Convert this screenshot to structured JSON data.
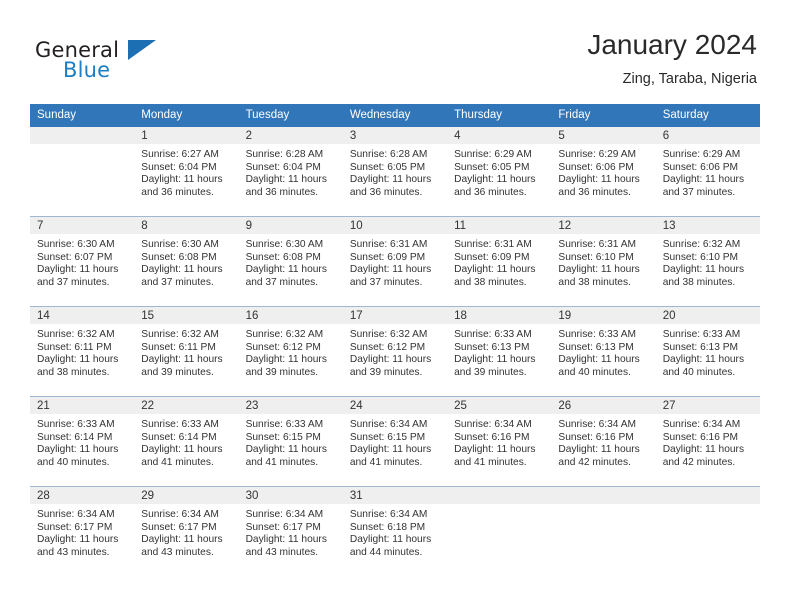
{
  "brand": {
    "name_part1": "General",
    "name_part2": "Blue",
    "accent_color": "#1d6fb4"
  },
  "header": {
    "title": "January 2024",
    "subtitle": "Zing, Taraba, Nigeria"
  },
  "calendar": {
    "header_bg_color": "#3076b8",
    "daynum_band_color": "#efefef",
    "weekday_headers": [
      "Sunday",
      "Monday",
      "Tuesday",
      "Wednesday",
      "Thursday",
      "Friday",
      "Saturday"
    ],
    "weeks": [
      [
        {
          "day": "",
          "sunrise": "",
          "sunset": "",
          "daylight_line1": "",
          "daylight_line2": "",
          "empty": true
        },
        {
          "day": "1",
          "sunrise": "Sunrise: 6:27 AM",
          "sunset": "Sunset: 6:04 PM",
          "daylight_line1": "Daylight: 11 hours",
          "daylight_line2": "and 36 minutes.",
          "empty": false
        },
        {
          "day": "2",
          "sunrise": "Sunrise: 6:28 AM",
          "sunset": "Sunset: 6:04 PM",
          "daylight_line1": "Daylight: 11 hours",
          "daylight_line2": "and 36 minutes.",
          "empty": false
        },
        {
          "day": "3",
          "sunrise": "Sunrise: 6:28 AM",
          "sunset": "Sunset: 6:05 PM",
          "daylight_line1": "Daylight: 11 hours",
          "daylight_line2": "and 36 minutes.",
          "empty": false
        },
        {
          "day": "4",
          "sunrise": "Sunrise: 6:29 AM",
          "sunset": "Sunset: 6:05 PM",
          "daylight_line1": "Daylight: 11 hours",
          "daylight_line2": "and 36 minutes.",
          "empty": false
        },
        {
          "day": "5",
          "sunrise": "Sunrise: 6:29 AM",
          "sunset": "Sunset: 6:06 PM",
          "daylight_line1": "Daylight: 11 hours",
          "daylight_line2": "and 36 minutes.",
          "empty": false
        },
        {
          "day": "6",
          "sunrise": "Sunrise: 6:29 AM",
          "sunset": "Sunset: 6:06 PM",
          "daylight_line1": "Daylight: 11 hours",
          "daylight_line2": "and 37 minutes.",
          "empty": false
        }
      ],
      [
        {
          "day": "7",
          "sunrise": "Sunrise: 6:30 AM",
          "sunset": "Sunset: 6:07 PM",
          "daylight_line1": "Daylight: 11 hours",
          "daylight_line2": "and 37 minutes.",
          "empty": false
        },
        {
          "day": "8",
          "sunrise": "Sunrise: 6:30 AM",
          "sunset": "Sunset: 6:08 PM",
          "daylight_line1": "Daylight: 11 hours",
          "daylight_line2": "and 37 minutes.",
          "empty": false
        },
        {
          "day": "9",
          "sunrise": "Sunrise: 6:30 AM",
          "sunset": "Sunset: 6:08 PM",
          "daylight_line1": "Daylight: 11 hours",
          "daylight_line2": "and 37 minutes.",
          "empty": false
        },
        {
          "day": "10",
          "sunrise": "Sunrise: 6:31 AM",
          "sunset": "Sunset: 6:09 PM",
          "daylight_line1": "Daylight: 11 hours",
          "daylight_line2": "and 37 minutes.",
          "empty": false
        },
        {
          "day": "11",
          "sunrise": "Sunrise: 6:31 AM",
          "sunset": "Sunset: 6:09 PM",
          "daylight_line1": "Daylight: 11 hours",
          "daylight_line2": "and 38 minutes.",
          "empty": false
        },
        {
          "day": "12",
          "sunrise": "Sunrise: 6:31 AM",
          "sunset": "Sunset: 6:10 PM",
          "daylight_line1": "Daylight: 11 hours",
          "daylight_line2": "and 38 minutes.",
          "empty": false
        },
        {
          "day": "13",
          "sunrise": "Sunrise: 6:32 AM",
          "sunset": "Sunset: 6:10 PM",
          "daylight_line1": "Daylight: 11 hours",
          "daylight_line2": "and 38 minutes.",
          "empty": false
        }
      ],
      [
        {
          "day": "14",
          "sunrise": "Sunrise: 6:32 AM",
          "sunset": "Sunset: 6:11 PM",
          "daylight_line1": "Daylight: 11 hours",
          "daylight_line2": "and 38 minutes.",
          "empty": false
        },
        {
          "day": "15",
          "sunrise": "Sunrise: 6:32 AM",
          "sunset": "Sunset: 6:11 PM",
          "daylight_line1": "Daylight: 11 hours",
          "daylight_line2": "and 39 minutes.",
          "empty": false
        },
        {
          "day": "16",
          "sunrise": "Sunrise: 6:32 AM",
          "sunset": "Sunset: 6:12 PM",
          "daylight_line1": "Daylight: 11 hours",
          "daylight_line2": "and 39 minutes.",
          "empty": false
        },
        {
          "day": "17",
          "sunrise": "Sunrise: 6:32 AM",
          "sunset": "Sunset: 6:12 PM",
          "daylight_line1": "Daylight: 11 hours",
          "daylight_line2": "and 39 minutes.",
          "empty": false
        },
        {
          "day": "18",
          "sunrise": "Sunrise: 6:33 AM",
          "sunset": "Sunset: 6:13 PM",
          "daylight_line1": "Daylight: 11 hours",
          "daylight_line2": "and 39 minutes.",
          "empty": false
        },
        {
          "day": "19",
          "sunrise": "Sunrise: 6:33 AM",
          "sunset": "Sunset: 6:13 PM",
          "daylight_line1": "Daylight: 11 hours",
          "daylight_line2": "and 40 minutes.",
          "empty": false
        },
        {
          "day": "20",
          "sunrise": "Sunrise: 6:33 AM",
          "sunset": "Sunset: 6:13 PM",
          "daylight_line1": "Daylight: 11 hours",
          "daylight_line2": "and 40 minutes.",
          "empty": false
        }
      ],
      [
        {
          "day": "21",
          "sunrise": "Sunrise: 6:33 AM",
          "sunset": "Sunset: 6:14 PM",
          "daylight_line1": "Daylight: 11 hours",
          "daylight_line2": "and 40 minutes.",
          "empty": false
        },
        {
          "day": "22",
          "sunrise": "Sunrise: 6:33 AM",
          "sunset": "Sunset: 6:14 PM",
          "daylight_line1": "Daylight: 11 hours",
          "daylight_line2": "and 41 minutes.",
          "empty": false
        },
        {
          "day": "23",
          "sunrise": "Sunrise: 6:33 AM",
          "sunset": "Sunset: 6:15 PM",
          "daylight_line1": "Daylight: 11 hours",
          "daylight_line2": "and 41 minutes.",
          "empty": false
        },
        {
          "day": "24",
          "sunrise": "Sunrise: 6:34 AM",
          "sunset": "Sunset: 6:15 PM",
          "daylight_line1": "Daylight: 11 hours",
          "daylight_line2": "and 41 minutes.",
          "empty": false
        },
        {
          "day": "25",
          "sunrise": "Sunrise: 6:34 AM",
          "sunset": "Sunset: 6:16 PM",
          "daylight_line1": "Daylight: 11 hours",
          "daylight_line2": "and 41 minutes.",
          "empty": false
        },
        {
          "day": "26",
          "sunrise": "Sunrise: 6:34 AM",
          "sunset": "Sunset: 6:16 PM",
          "daylight_line1": "Daylight: 11 hours",
          "daylight_line2": "and 42 minutes.",
          "empty": false
        },
        {
          "day": "27",
          "sunrise": "Sunrise: 6:34 AM",
          "sunset": "Sunset: 6:16 PM",
          "daylight_line1": "Daylight: 11 hours",
          "daylight_line2": "and 42 minutes.",
          "empty": false
        }
      ],
      [
        {
          "day": "28",
          "sunrise": "Sunrise: 6:34 AM",
          "sunset": "Sunset: 6:17 PM",
          "daylight_line1": "Daylight: 11 hours",
          "daylight_line2": "and 43 minutes.",
          "empty": false
        },
        {
          "day": "29",
          "sunrise": "Sunrise: 6:34 AM",
          "sunset": "Sunset: 6:17 PM",
          "daylight_line1": "Daylight: 11 hours",
          "daylight_line2": "and 43 minutes.",
          "empty": false
        },
        {
          "day": "30",
          "sunrise": "Sunrise: 6:34 AM",
          "sunset": "Sunset: 6:17 PM",
          "daylight_line1": "Daylight: 11 hours",
          "daylight_line2": "and 43 minutes.",
          "empty": false
        },
        {
          "day": "31",
          "sunrise": "Sunrise: 6:34 AM",
          "sunset": "Sunset: 6:18 PM",
          "daylight_line1": "Daylight: 11 hours",
          "daylight_line2": "and 44 minutes.",
          "empty": false
        },
        {
          "day": "",
          "sunrise": "",
          "sunset": "",
          "daylight_line1": "",
          "daylight_line2": "",
          "empty": true
        },
        {
          "day": "",
          "sunrise": "",
          "sunset": "",
          "daylight_line1": "",
          "daylight_line2": "",
          "empty": true
        },
        {
          "day": "",
          "sunrise": "",
          "sunset": "",
          "daylight_line1": "",
          "daylight_line2": "",
          "empty": true
        }
      ]
    ]
  }
}
